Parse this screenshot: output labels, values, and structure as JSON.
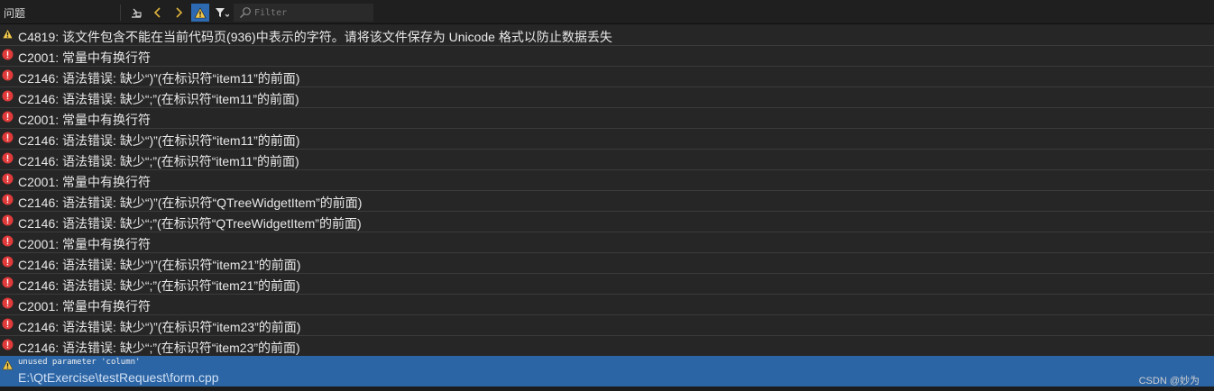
{
  "panel": {
    "title": "问题"
  },
  "toolbar": {
    "filter_placeholder": "Filter",
    "buttons": [
      {
        "name": "clear-issues-button",
        "icon": "clear-icon"
      },
      {
        "name": "previous-issue-button",
        "icon": "chevron-left-icon"
      },
      {
        "name": "next-issue-button",
        "icon": "chevron-right-icon"
      },
      {
        "name": "warnings-toggle-button",
        "icon": "warning-icon",
        "active": true
      },
      {
        "name": "filter-button",
        "icon": "funnel-icon"
      }
    ]
  },
  "colors": {
    "warning": "#f2c94c",
    "error": "#e03a3a",
    "selection": "#2c65a5"
  },
  "issues": [
    {
      "type": "warning",
      "text": "C4819: 该文件包含不能在当前代码页(936)中表示的字符。请将该文件保存为 Unicode 格式以防止数据丢失"
    },
    {
      "type": "error",
      "text": "C2001: 常量中有换行符"
    },
    {
      "type": "error",
      "text": "C2146: 语法错误: 缺少“)”(在标识符“item11”的前面)"
    },
    {
      "type": "error",
      "text": "C2146: 语法错误: 缺少“;”(在标识符“item11”的前面)"
    },
    {
      "type": "error",
      "text": "C2001: 常量中有换行符"
    },
    {
      "type": "error",
      "text": "C2146: 语法错误: 缺少“)”(在标识符“item11”的前面)"
    },
    {
      "type": "error",
      "text": "C2146: 语法错误: 缺少“;”(在标识符“item11”的前面)"
    },
    {
      "type": "error",
      "text": "C2001: 常量中有换行符"
    },
    {
      "type": "error",
      "text": "C2146: 语法错误: 缺少“)”(在标识符“QTreeWidgetItem”的前面)"
    },
    {
      "type": "error",
      "text": "C2146: 语法错误: 缺少“;”(在标识符“QTreeWidgetItem”的前面)"
    },
    {
      "type": "error",
      "text": "C2001: 常量中有换行符"
    },
    {
      "type": "error",
      "text": "C2146: 语法错误: 缺少“)”(在标识符“item21”的前面)"
    },
    {
      "type": "error",
      "text": "C2146: 语法错误: 缺少“;”(在标识符“item21”的前面)"
    },
    {
      "type": "error",
      "text": "C2001: 常量中有换行符"
    },
    {
      "type": "error",
      "text": "C2146: 语法错误: 缺少“)”(在标识符“item23”的前面)"
    },
    {
      "type": "error",
      "text": "C2146: 语法错误: 缺少“;”(在标识符“item23”的前面)"
    }
  ],
  "selected": {
    "type": "warning",
    "message": "unused parameter 'column'",
    "file": "E:\\QtExercise\\testRequest\\form.cpp"
  },
  "watermark": "CSDN @妙为"
}
